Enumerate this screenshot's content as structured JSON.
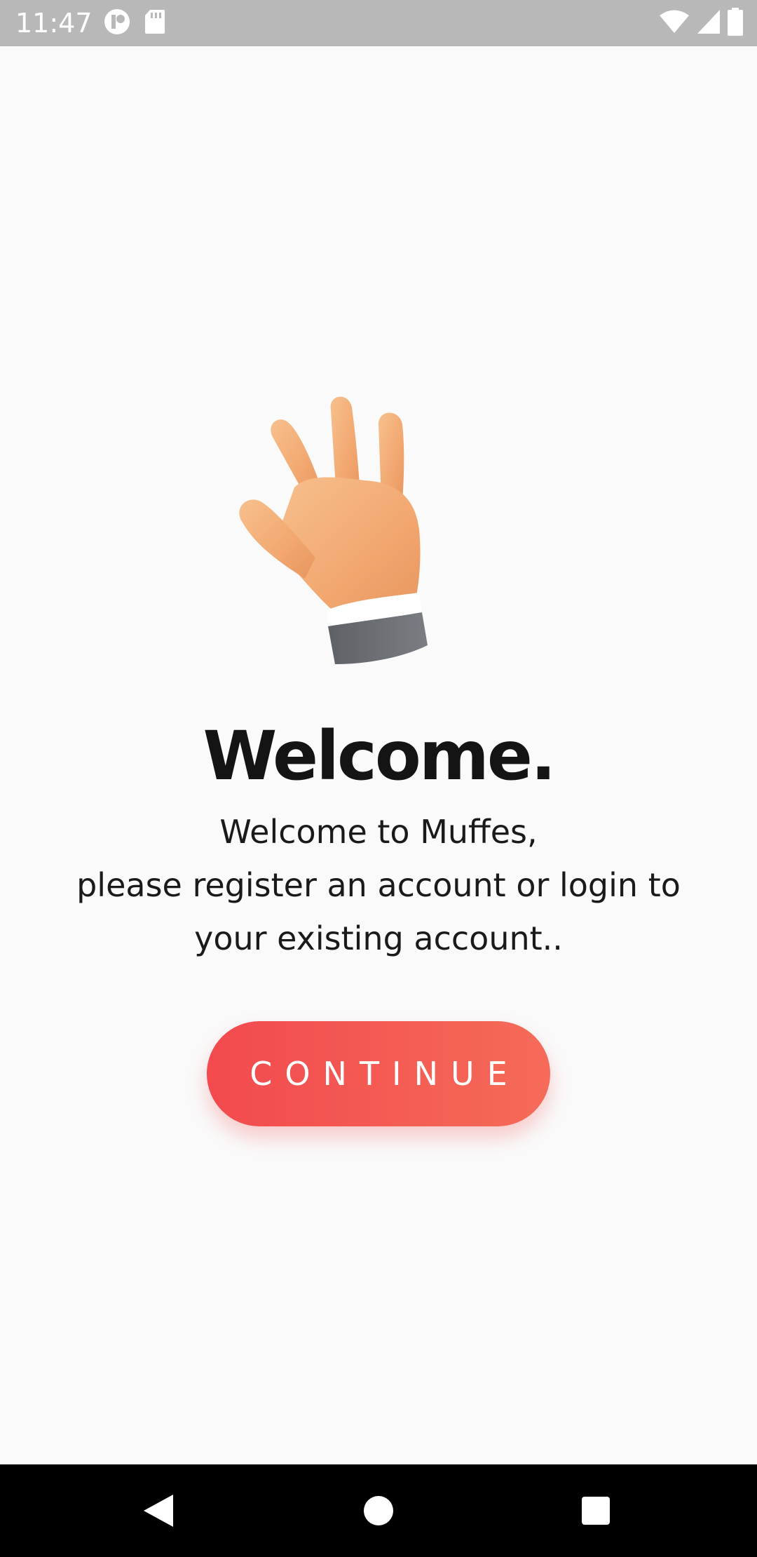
{
  "status_bar": {
    "time": "11:47",
    "left_icons": [
      "app-notification-icon",
      "sd-card-icon"
    ],
    "right_icons": [
      "wifi-icon",
      "signal-icon",
      "battery-icon"
    ]
  },
  "main": {
    "illustration_icon": "waving-hand-icon",
    "title": "Welcome.",
    "message_lines": [
      "Welcome to Muffes,",
      "please register an account or login to",
      "your existing account.."
    ],
    "continue_label": "CONTINUE"
  },
  "nav_bar": {
    "icons": [
      "back-icon",
      "home-icon",
      "recents-icon"
    ]
  },
  "colors": {
    "accent_start": "#f24a4e",
    "accent_end": "#f56b58",
    "background": "#fafafa",
    "status_bar": "#b8b8b8",
    "nav_bar": "#000000"
  }
}
